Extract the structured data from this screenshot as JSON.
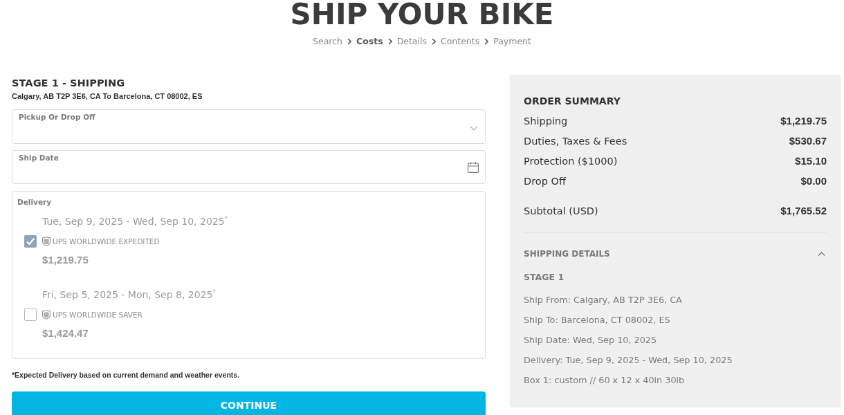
{
  "page": {
    "title": "SHIP YOUR BIKE"
  },
  "breadcrumb": [
    {
      "label": "Search",
      "selected": false
    },
    {
      "label": "Costs",
      "selected": true
    },
    {
      "label": "Details",
      "selected": false
    },
    {
      "label": "Contents",
      "selected": false
    },
    {
      "label": "Payment",
      "selected": false
    }
  ],
  "shipping_form": {
    "heading": "STAGE 1 - SHIPPING",
    "route": "Calgary, AB T2P 3E6, CA To Barcelona, CT 08002, ES",
    "fields": [
      {
        "kind": "select",
        "label": "Pickup Or Drop Off"
      },
      {
        "kind": "date",
        "label": "Ship Date"
      }
    ],
    "delivery": {
      "label": "Delivery",
      "options": [
        {
          "dates": "Tue, Sep 9, 2025 - Wed, Sep 10, 2025$^{*}$",
          "service": "UPS WORLDWIDE EXPEDITED",
          "price": "$1,219.75",
          "checked": true
        },
        {
          "dates": "Fri, Sep 5, 2025 - Mon, Sep 8, 2025$^{*}$",
          "service": "UPS WORLDWIDE SAVER",
          "price": "$1,424.47",
          "checked": false
        }
      ]
    },
    "footnote": "*Expected Delivery based on current demand and weather events.",
    "continue_button": "CONTINUE"
  },
  "order_summary": {
    "title": "ORDER SUMMARY",
    "rows": [
      {
        "label": "Shipping",
        "value": "$1,219.75"
      },
      {
        "label": "Duties, Taxes & Fees",
        "value": "$530.67"
      },
      {
        "label": "Protection ($1000)",
        "value": "$15.10"
      },
      {
        "label": "Drop Off",
        "value": "$0.00"
      }
    ],
    "subtotal": {
      "label": "Subtotal (USD)",
      "value": "$1,765.52"
    }
  },
  "shipping_details": {
    "title": "SHIPPING DETAILS",
    "expanded": true,
    "stage": "STAGE 1",
    "lines": [
      "Ship From: Calgary, AB T2P 3E6, CA",
      "Ship To: Barcelona, CT 08002, ES",
      "Ship Date: Wed, Sep 10, 2025",
      "Delivery: Tue, Sep 9, 2025 - Wed, Sep 10, 2025",
      "Box 1: custom // 60 x 12 x 40in 30lb"
    ]
  }
}
